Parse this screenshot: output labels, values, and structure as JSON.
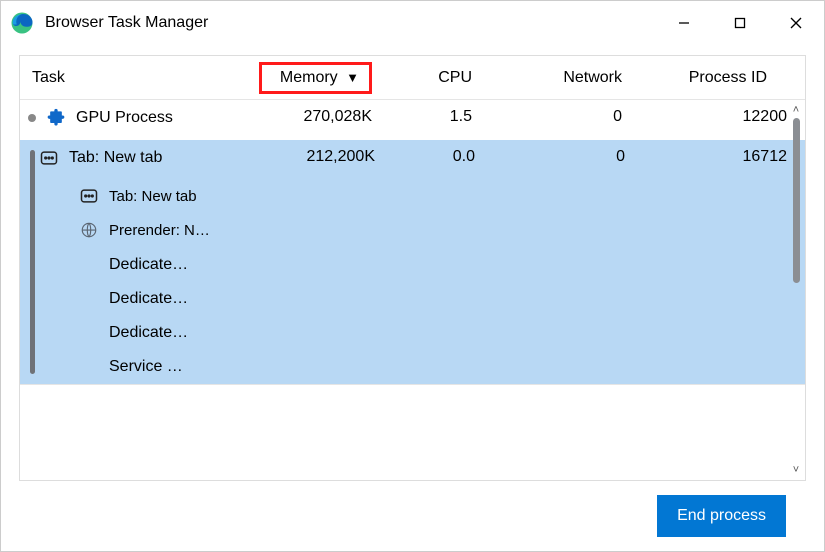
{
  "window": {
    "title": "Browser Task Manager",
    "buttons": {
      "min": "—",
      "max": "☐",
      "close": "✕"
    }
  },
  "columns": {
    "task": "Task",
    "memory": "Memory",
    "cpu": "CPU",
    "network": "Network",
    "pid": "Process ID",
    "sort_indicator": "▼"
  },
  "rows": [
    {
      "icon": "puzzle",
      "label": "GPU Process",
      "memory": "270,028K",
      "cpu": "1.5",
      "network": "0",
      "pid": "12200",
      "selected": false
    },
    {
      "icon": "tab",
      "label": "Tab: New tab",
      "memory": "212,200K",
      "cpu": "0.0",
      "network": "0",
      "pid": "16712",
      "selected": true,
      "children": [
        {
          "icon": "tab",
          "label": "Tab: New tab"
        },
        {
          "icon": "globe",
          "label": "Prerender: N…"
        },
        {
          "icon": "none",
          "label": "Dedicated W…"
        },
        {
          "icon": "none",
          "label": "Dedicated W…"
        },
        {
          "icon": "none",
          "label": "Dedicated W…"
        },
        {
          "icon": "none",
          "label": "Service Work…"
        }
      ]
    }
  ],
  "footer": {
    "end_process": "End process"
  }
}
